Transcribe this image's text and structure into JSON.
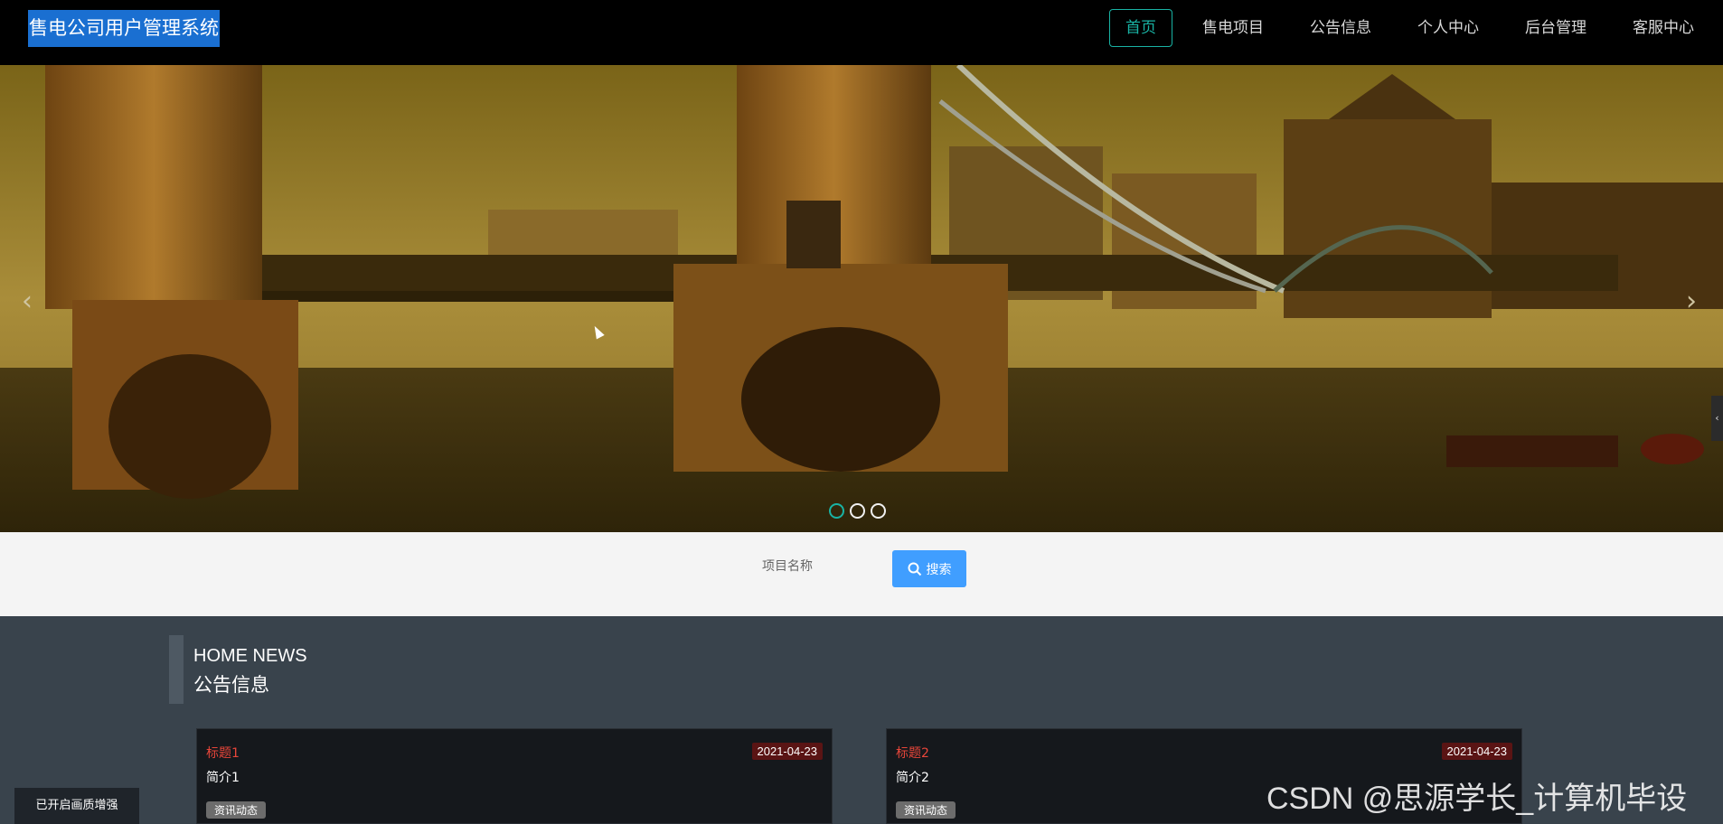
{
  "header": {
    "brand": "售电公司用户管理系统",
    "nav": [
      {
        "label": "首页",
        "active": true
      },
      {
        "label": "售电项目",
        "active": false
      },
      {
        "label": "公告信息",
        "active": false
      },
      {
        "label": "个人中心",
        "active": false
      },
      {
        "label": "后台管理",
        "active": false
      },
      {
        "label": "客服中心",
        "active": false
      }
    ]
  },
  "banner": {
    "prev_glyph": "‹",
    "next_glyph": "›",
    "slide_count": 3,
    "active_slide": 1,
    "side_tab_glyph": "‹"
  },
  "search": {
    "label": "项目名称",
    "button_label": "搜索",
    "button_icon": "search-icon"
  },
  "news": {
    "heading_en": "HOME NEWS",
    "heading_cn": "公告信息",
    "items": [
      {
        "title": "标题1",
        "date": "2021-04-23",
        "intro": "简介1",
        "tag": "资讯动态"
      },
      {
        "title": "标题2",
        "date": "2021-04-23",
        "intro": "简介2",
        "tag": "资讯动态"
      }
    ]
  },
  "overlay": {
    "enhance_badge": "已开启画质增强",
    "watermark": "CSDN @思源学长_计算机毕设"
  },
  "colors": {
    "accent": "#19b3a4",
    "search_button": "#409eff",
    "brand_highlight": "#1a6fd1",
    "news_bg": "#39434c",
    "date_badge": "#5a1414",
    "title_red": "#e8463a"
  }
}
